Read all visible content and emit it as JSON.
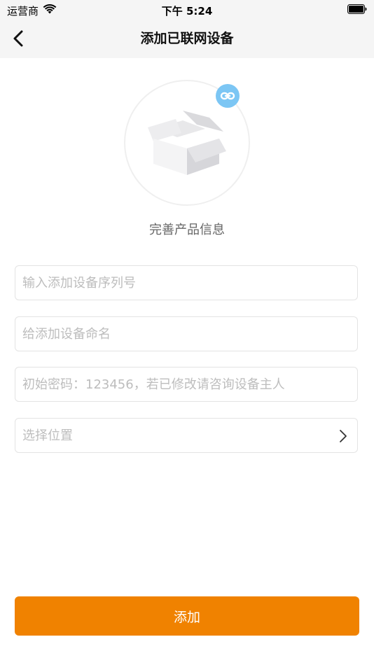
{
  "status_bar": {
    "carrier": "运营商",
    "time": "下午 5:24",
    "wifi_icon": "wifi-icon",
    "battery_icon": "battery-icon"
  },
  "nav": {
    "title": "添加已联网设备",
    "back_icon": "chevron-left-icon"
  },
  "illustration": {
    "box_icon": "open-box-icon",
    "link_icon": "link-icon",
    "caption": "完善产品信息"
  },
  "form": {
    "serial_placeholder": "输入添加设备序列号",
    "name_placeholder": "给添加设备命名",
    "password_placeholder": "初始密码：123456，若已修改请咨询设备主人",
    "location_label": "选择位置",
    "location_chevron": "chevron-right-icon"
  },
  "actions": {
    "add_label": "添加"
  },
  "colors": {
    "accent": "#f08200",
    "link_badge": "#7cc6f4",
    "bar_background": "#f5f5f5",
    "placeholder": "#bdbdbd"
  }
}
